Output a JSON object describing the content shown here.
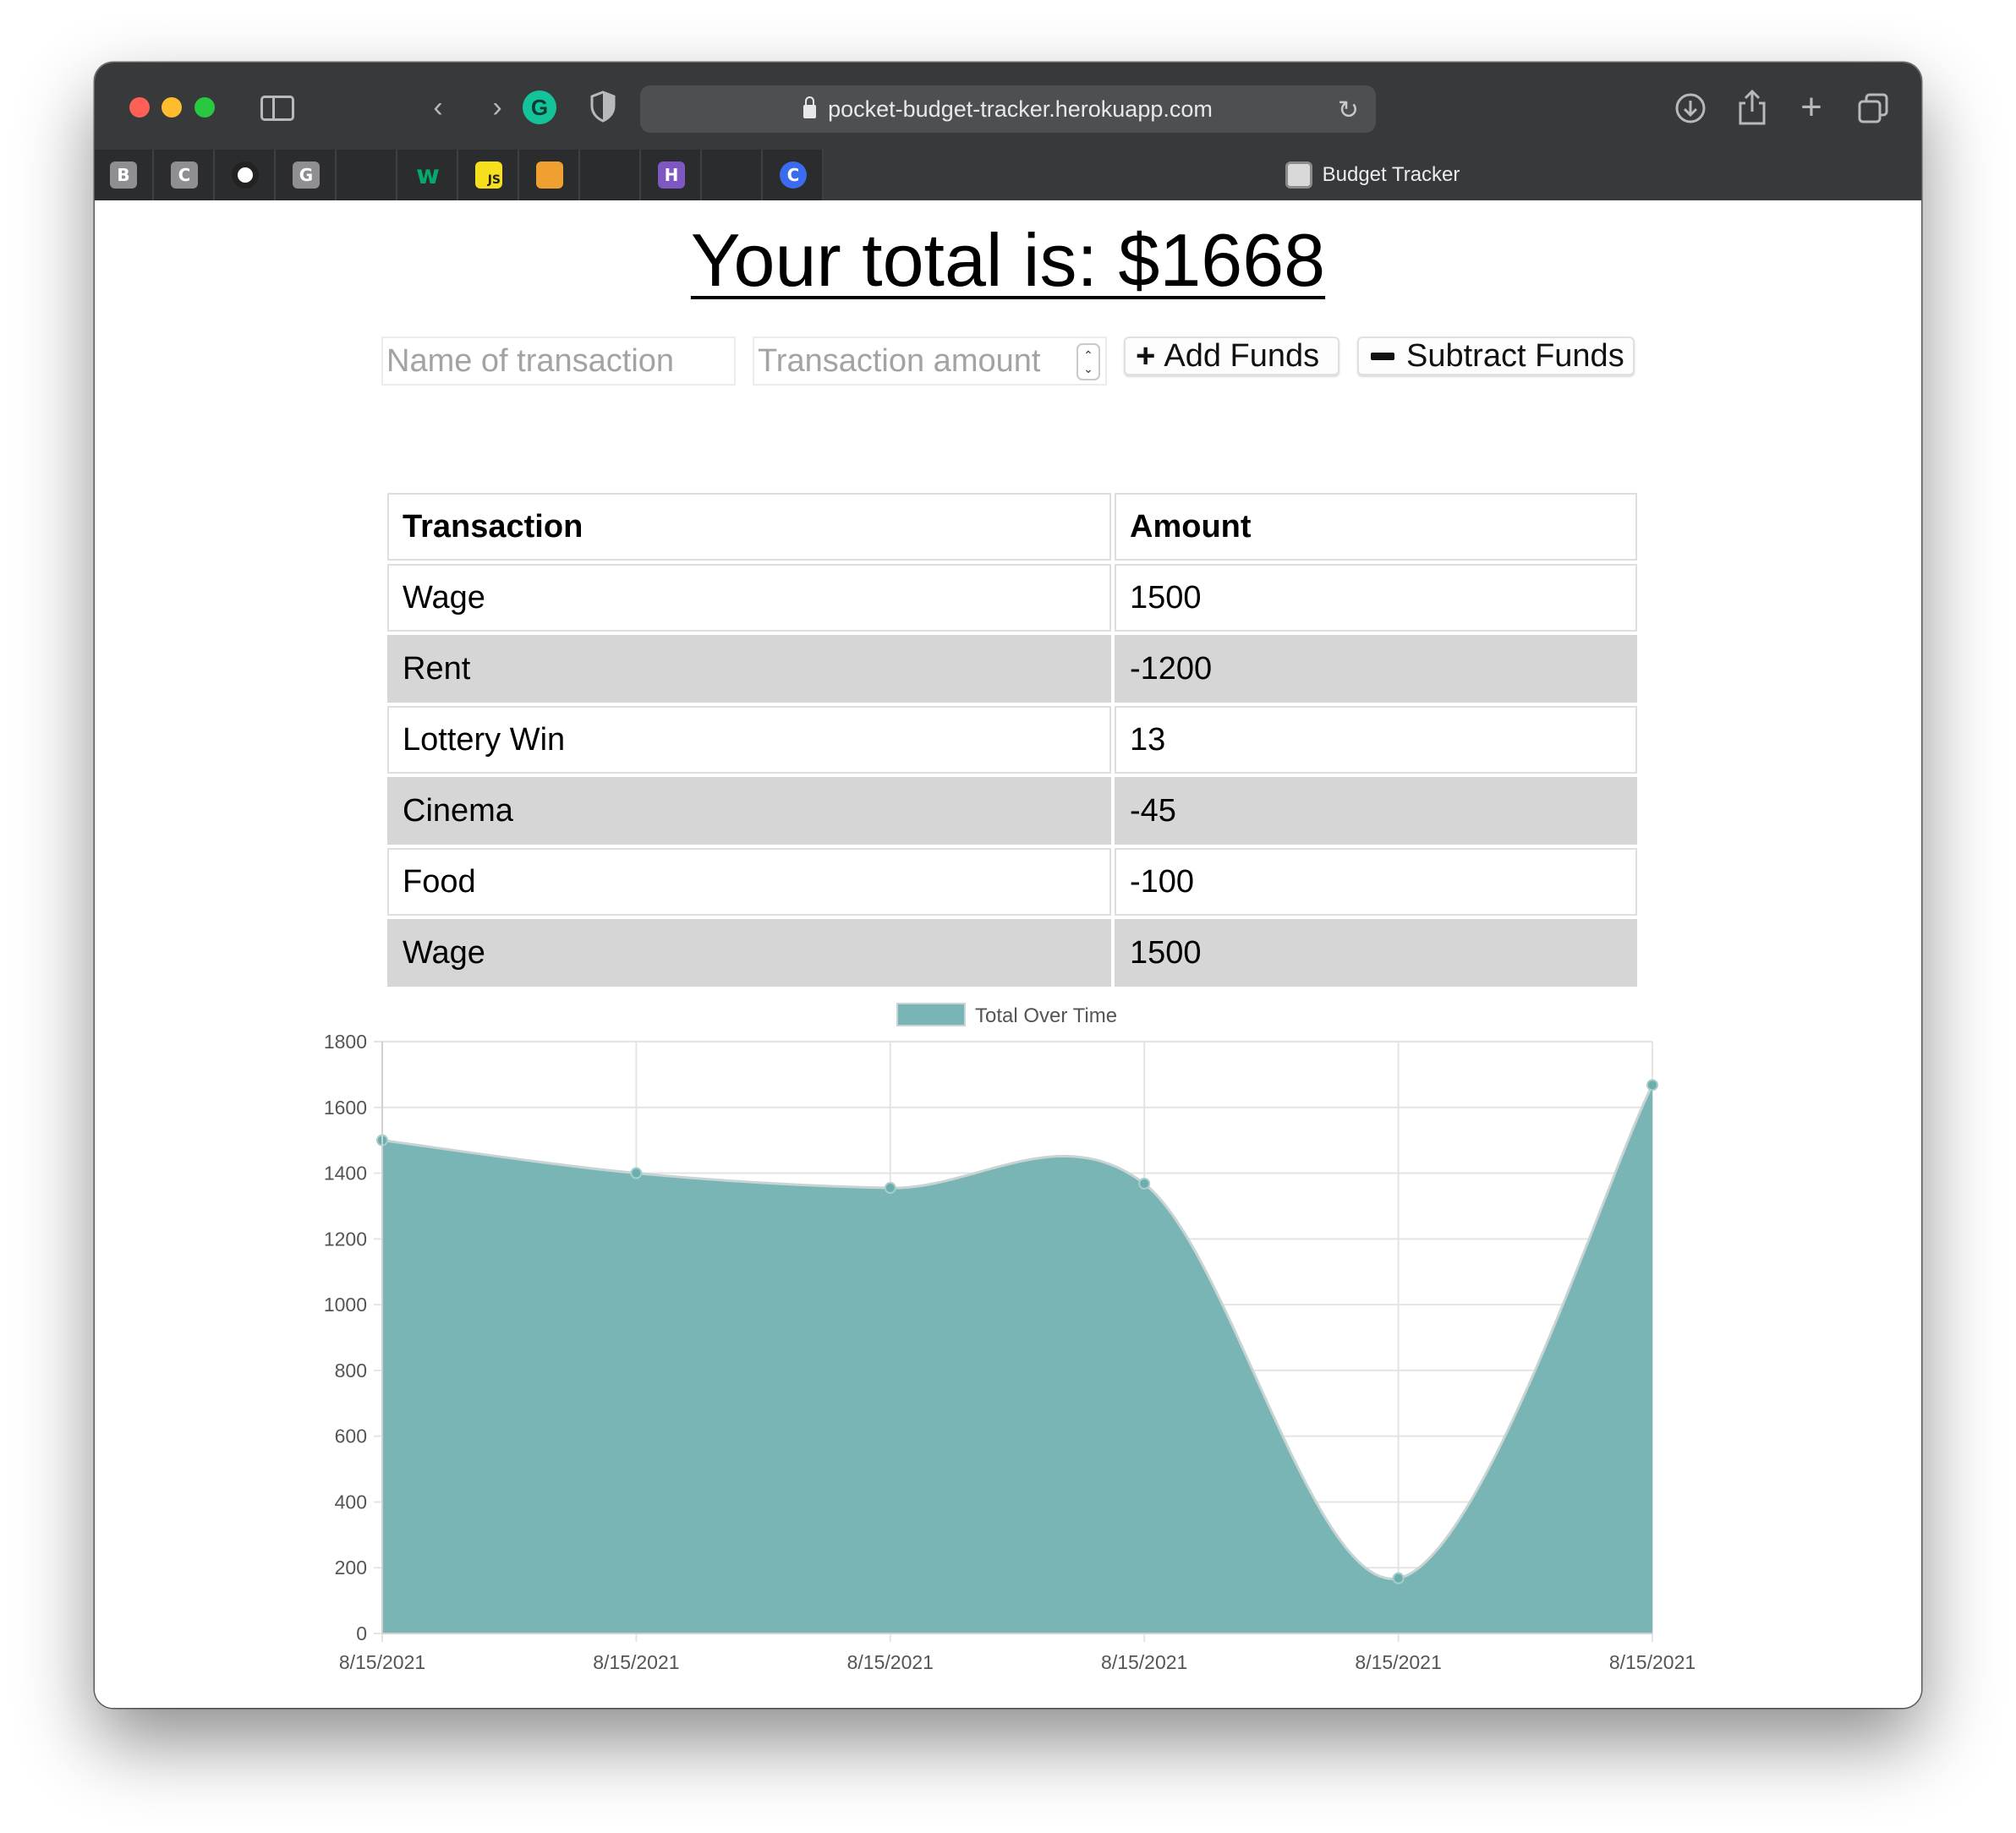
{
  "browser": {
    "url": "pocket-budget-tracker.herokuapp.com",
    "active_tab_title": "Budget Tracker",
    "favorites": [
      {
        "glyph": "B",
        "color": "#8e8e93",
        "name": "favorite-b"
      },
      {
        "glyph": "C",
        "color": "#8e8e93",
        "name": "favorite-c"
      },
      {
        "glyph": "",
        "color": "#ffffff",
        "name": "favorite-github"
      },
      {
        "glyph": "G",
        "color": "#8e8e93",
        "name": "favorite-g"
      },
      {
        "glyph": "",
        "color": "#3b82f6",
        "name": "favorite-flag"
      },
      {
        "glyph": "w",
        "color": "#04aa6d",
        "name": "favorite-w3schools"
      },
      {
        "glyph": "JS",
        "color": "#f7df1e",
        "name": "favorite-js"
      },
      {
        "glyph": "",
        "color": "#f0a030",
        "name": "favorite-tree"
      },
      {
        "glyph": "",
        "color": "#28c39a",
        "name": "favorite-leaf"
      },
      {
        "glyph": "H",
        "color": "#7e57c2",
        "name": "favorite-heroku"
      },
      {
        "glyph": "",
        "color": "#4caf50",
        "name": "favorite-mongodb"
      },
      {
        "glyph": "C",
        "color": "#3b6cf0",
        "name": "favorite-c-circle"
      }
    ]
  },
  "app": {
    "total_text": "Your total is: $1668",
    "name_placeholder": "Name of transaction",
    "amount_placeholder": "Transaction amount",
    "add_label": "Add Funds",
    "subtract_label": "Subtract Funds",
    "table": {
      "headers": [
        "Transaction",
        "Amount"
      ],
      "rows": [
        [
          "Wage",
          "1500"
        ],
        [
          "Rent",
          "-1200"
        ],
        [
          "Lottery Win",
          "13"
        ],
        [
          "Cinema",
          "-45"
        ],
        [
          "Food",
          "-100"
        ],
        [
          "Wage",
          "1500"
        ]
      ]
    }
  },
  "chart_data": {
    "type": "area",
    "legend": "Total Over Time",
    "legend_position": "top",
    "x": [
      "8/15/2021",
      "8/15/2021",
      "8/15/2021",
      "8/15/2021",
      "8/15/2021",
      "8/15/2021"
    ],
    "series": [
      {
        "name": "Total Over Time",
        "values": [
          1500,
          1400,
          1355,
          1368,
          168,
          1668
        ]
      }
    ],
    "ylim": [
      0,
      1800
    ],
    "yticks": [
      0,
      200,
      400,
      600,
      800,
      1000,
      1200,
      1400,
      1600,
      1800
    ],
    "grid": true,
    "fill_color": "#79b5b5",
    "line_color": "#c8d3d3",
    "point_color": "#6aaeae"
  }
}
